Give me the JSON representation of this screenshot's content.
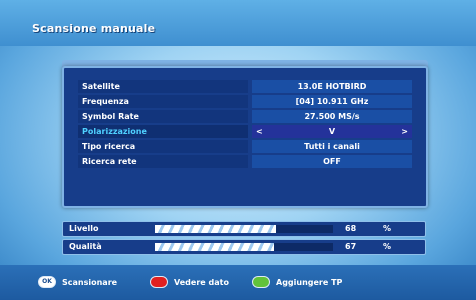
{
  "title": "Scansione manuale",
  "rows": [
    {
      "label": "Satellite",
      "value": "13.0E HOTBIRD"
    },
    {
      "label": "Frequenza",
      "value": "[04] 10.911 GHz"
    },
    {
      "label": "Symbol Rate",
      "value": "27.500 MS/s"
    },
    {
      "label": "Polarizzazione",
      "value": "V"
    },
    {
      "label": "Tipo ricerca",
      "value": "Tutti i canali"
    },
    {
      "label": "Ricerca rete",
      "value": "OFF"
    }
  ],
  "selected_row": "Polarizzazione",
  "signal": {
    "level": {
      "label": "Livello",
      "value": "68",
      "unit": "%",
      "fraction": 0.68
    },
    "quality": {
      "label": "Qualità",
      "value": "67",
      "unit": "%",
      "fraction": 0.67
    }
  },
  "footer": {
    "ok_icon_text": "OK",
    "ok_label": "Scansionare",
    "red_label": "Vedere dato",
    "green_label": "Aggiungere TP"
  },
  "colors": {
    "panel": "#173d8a",
    "highlight_label": "#4fd0ff",
    "red_button": "#e02020",
    "green_button": "#62c23a"
  }
}
